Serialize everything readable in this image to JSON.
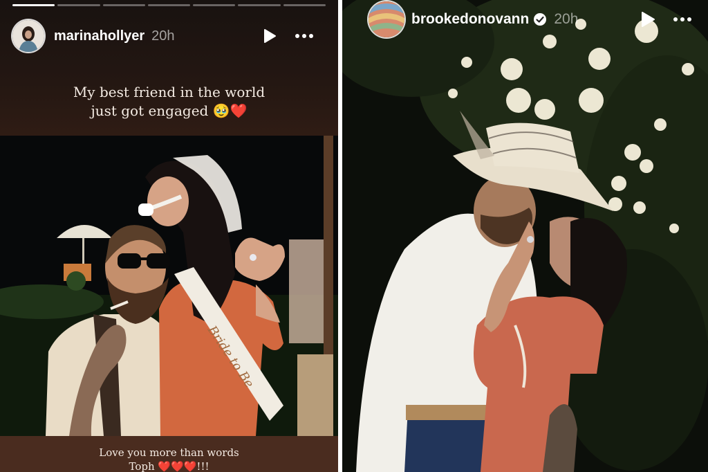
{
  "left_story": {
    "progress_total": 7,
    "progress_done": 1,
    "username": "marinahollyer",
    "time": "20h",
    "caption_top_line1": "My best friend in the world",
    "caption_top_line2": "just got engaged 🥹❤️",
    "caption_bottom_line1": "Love you more than words",
    "caption_bottom_line2": "Toph ❤️❤️❤️!!!",
    "sash_text": "Bride to Be",
    "icons": [
      "play-icon",
      "more-icon"
    ]
  },
  "right_story": {
    "username": "brookedonovann",
    "time": "20h",
    "verified": true,
    "icons": [
      "verified-badge-icon",
      "play-icon",
      "more-icon"
    ]
  },
  "colors": {
    "left_bg": "#241712",
    "band": "#4a2c1f",
    "dress": "#d2683f",
    "heart": "#e0212f"
  }
}
